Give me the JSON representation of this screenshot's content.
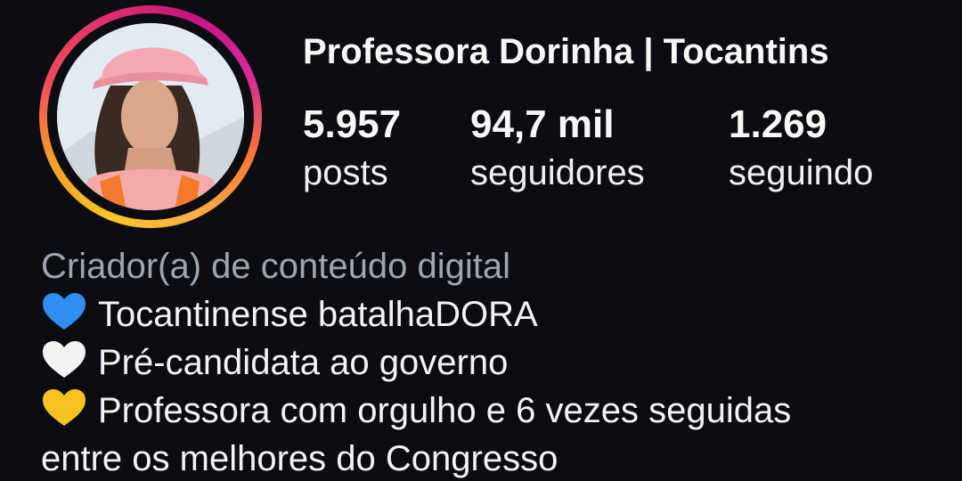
{
  "profile": {
    "username": "Professora Dorinha | Tocantins",
    "stats": {
      "posts": {
        "value": "5.957",
        "label": "posts"
      },
      "followers": {
        "value": "94,7 mil",
        "label": "seguidores"
      },
      "following": {
        "value": "1.269",
        "label": "seguindo"
      }
    },
    "category": "Criador(a) de conteúdo digital",
    "bio": [
      {
        "icon": "blue-heart-icon",
        "color": "#2f8ff0",
        "text": "Tocantinense batalhaDORA"
      },
      {
        "icon": "white-heart-icon",
        "color": "#f2f2f2",
        "text": "Pré-candidata ao governo"
      },
      {
        "icon": "yellow-heart-icon",
        "color": "#f7c21f",
        "text": "Professora com orgulho e 6 vezes seguidas"
      },
      {
        "icon": "",
        "color": "",
        "text": "entre os melhores do Congresso"
      }
    ]
  },
  "colors": {
    "background": "#0c0d12",
    "text": "#f5f5f5",
    "category": "#a1a4ad",
    "story_ring": [
      "#f9c623",
      "#ef4b5d",
      "#d6249f"
    ]
  }
}
